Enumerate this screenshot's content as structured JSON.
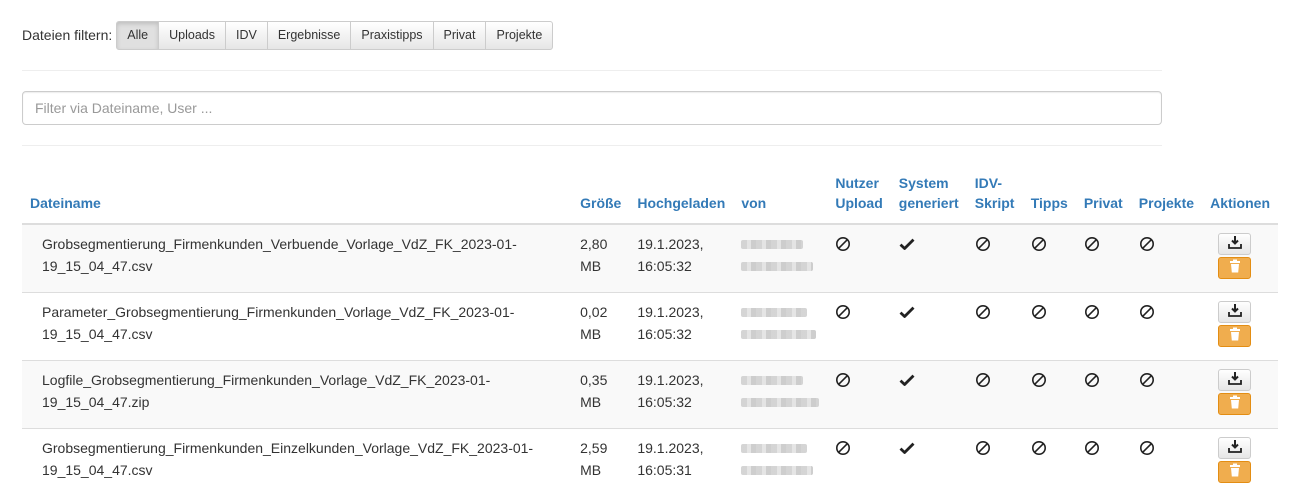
{
  "filter": {
    "label": "Dateien filtern:",
    "options": [
      "Alle",
      "Uploads",
      "IDV",
      "Ergebnisse",
      "Praxistipps",
      "Privat",
      "Projekte"
    ],
    "active": "Alle"
  },
  "search": {
    "placeholder": "Filter via Dateiname, User ..."
  },
  "table": {
    "headers": {
      "dateiname": "Dateiname",
      "groesse": "Größe",
      "hochgeladen": "Hochgeladen",
      "von": "von",
      "nutzer_upload_1": "Nutzer",
      "nutzer_upload_2": "Upload",
      "system_generiert_1": "System",
      "system_generiert_2": "generiert",
      "idv_skript_1": "IDV-",
      "idv_skript_2": "Skript",
      "tipps": "Tipps",
      "privat": "Privat",
      "projekte": "Projekte",
      "aktionen": "Aktionen"
    },
    "rows": [
      {
        "name_1": "Grobsegmentierung_Firmenkunden_Verbuende_Vorlage_VdZ_FK_2023-01-",
        "name_2": "19_15_04_47.csv",
        "size_1": "2,80",
        "size_2": "MB",
        "date_1": "19.1.2023,",
        "date_2": "16:05:32",
        "user_upload": "no-icon",
        "system_generated": "check-icon",
        "idv": "no-icon",
        "tipps": "no-icon",
        "privat": "no-icon",
        "projekte": "no-icon"
      },
      {
        "name_1": "Parameter_Grobsegmentierung_Firmenkunden_Vorlage_VdZ_FK_2023-01-",
        "name_2": "19_15_04_47.csv",
        "size_1": "0,02",
        "size_2": "MB",
        "date_1": "19.1.2023,",
        "date_2": "16:05:32",
        "user_upload": "no-icon",
        "system_generated": "check-icon",
        "idv": "no-icon",
        "tipps": "no-icon",
        "privat": "no-icon",
        "projekte": "no-icon"
      },
      {
        "name_1": "Logfile_Grobsegmentierung_Firmenkunden_Vorlage_VdZ_FK_2023-01-",
        "name_2": "19_15_04_47.zip",
        "size_1": "0,35",
        "size_2": "MB",
        "date_1": "19.1.2023,",
        "date_2": "16:05:32",
        "user_upload": "no-icon",
        "system_generated": "check-icon",
        "idv": "no-icon",
        "tipps": "no-icon",
        "privat": "no-icon",
        "projekte": "no-icon"
      },
      {
        "name_1": "Grobsegmentierung_Firmenkunden_Einzelkunden_Vorlage_VdZ_FK_2023-01-",
        "name_2": "19_15_04_47.csv",
        "size_1": "2,59",
        "size_2": "MB",
        "date_1": "19.1.2023,",
        "date_2": "16:05:31",
        "user_upload": "no-icon",
        "system_generated": "check-icon",
        "idv": "no-icon",
        "tipps": "no-icon",
        "privat": "no-icon",
        "projekte": "no-icon"
      }
    ]
  },
  "colors": {
    "header_link": "#337ab7",
    "delete_button": "#f0ad4e",
    "row_stripe": "#f9f9f9"
  }
}
